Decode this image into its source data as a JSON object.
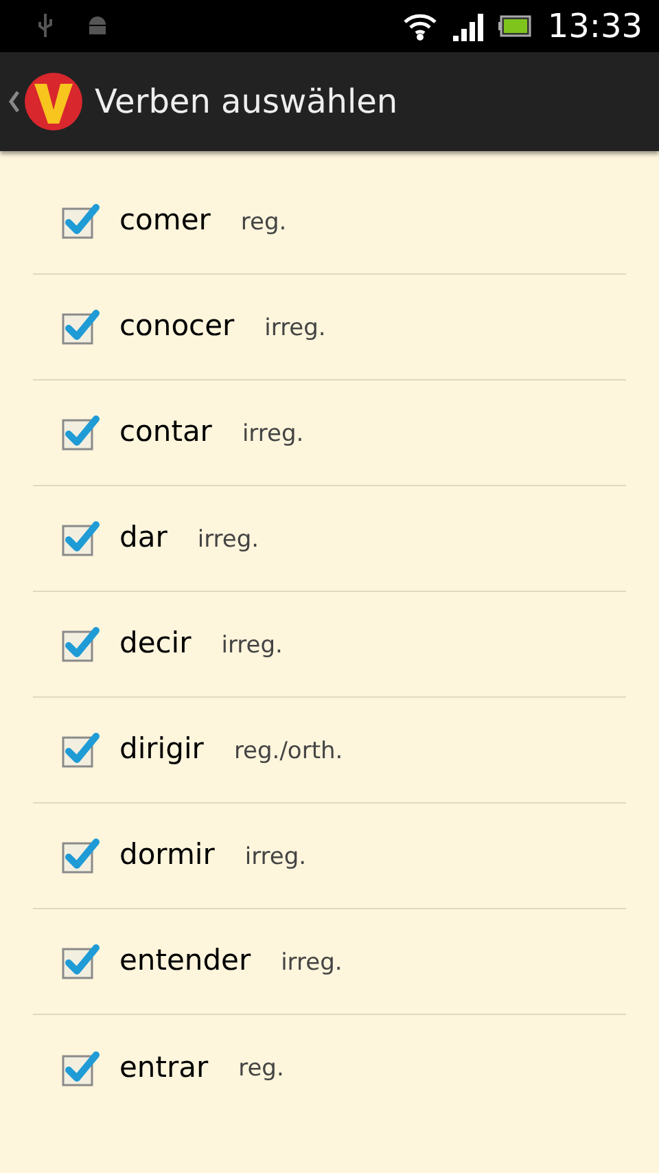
{
  "status_bar": {
    "time": "13:33"
  },
  "action_bar": {
    "title": "Verben auswählen"
  },
  "verbs": [
    {
      "verb": "comer",
      "type": "reg.",
      "checked": true
    },
    {
      "verb": "conocer",
      "type": "irreg.",
      "checked": true
    },
    {
      "verb": "contar",
      "type": "irreg.",
      "checked": true
    },
    {
      "verb": "dar",
      "type": "irreg.",
      "checked": true
    },
    {
      "verb": "decir",
      "type": "irreg.",
      "checked": true
    },
    {
      "verb": "dirigir",
      "type": "reg./orth.",
      "checked": true
    },
    {
      "verb": "dormir",
      "type": "irreg.",
      "checked": true
    },
    {
      "verb": "entender",
      "type": "irreg.",
      "checked": true
    },
    {
      "verb": "entrar",
      "type": "reg.",
      "checked": true
    }
  ]
}
